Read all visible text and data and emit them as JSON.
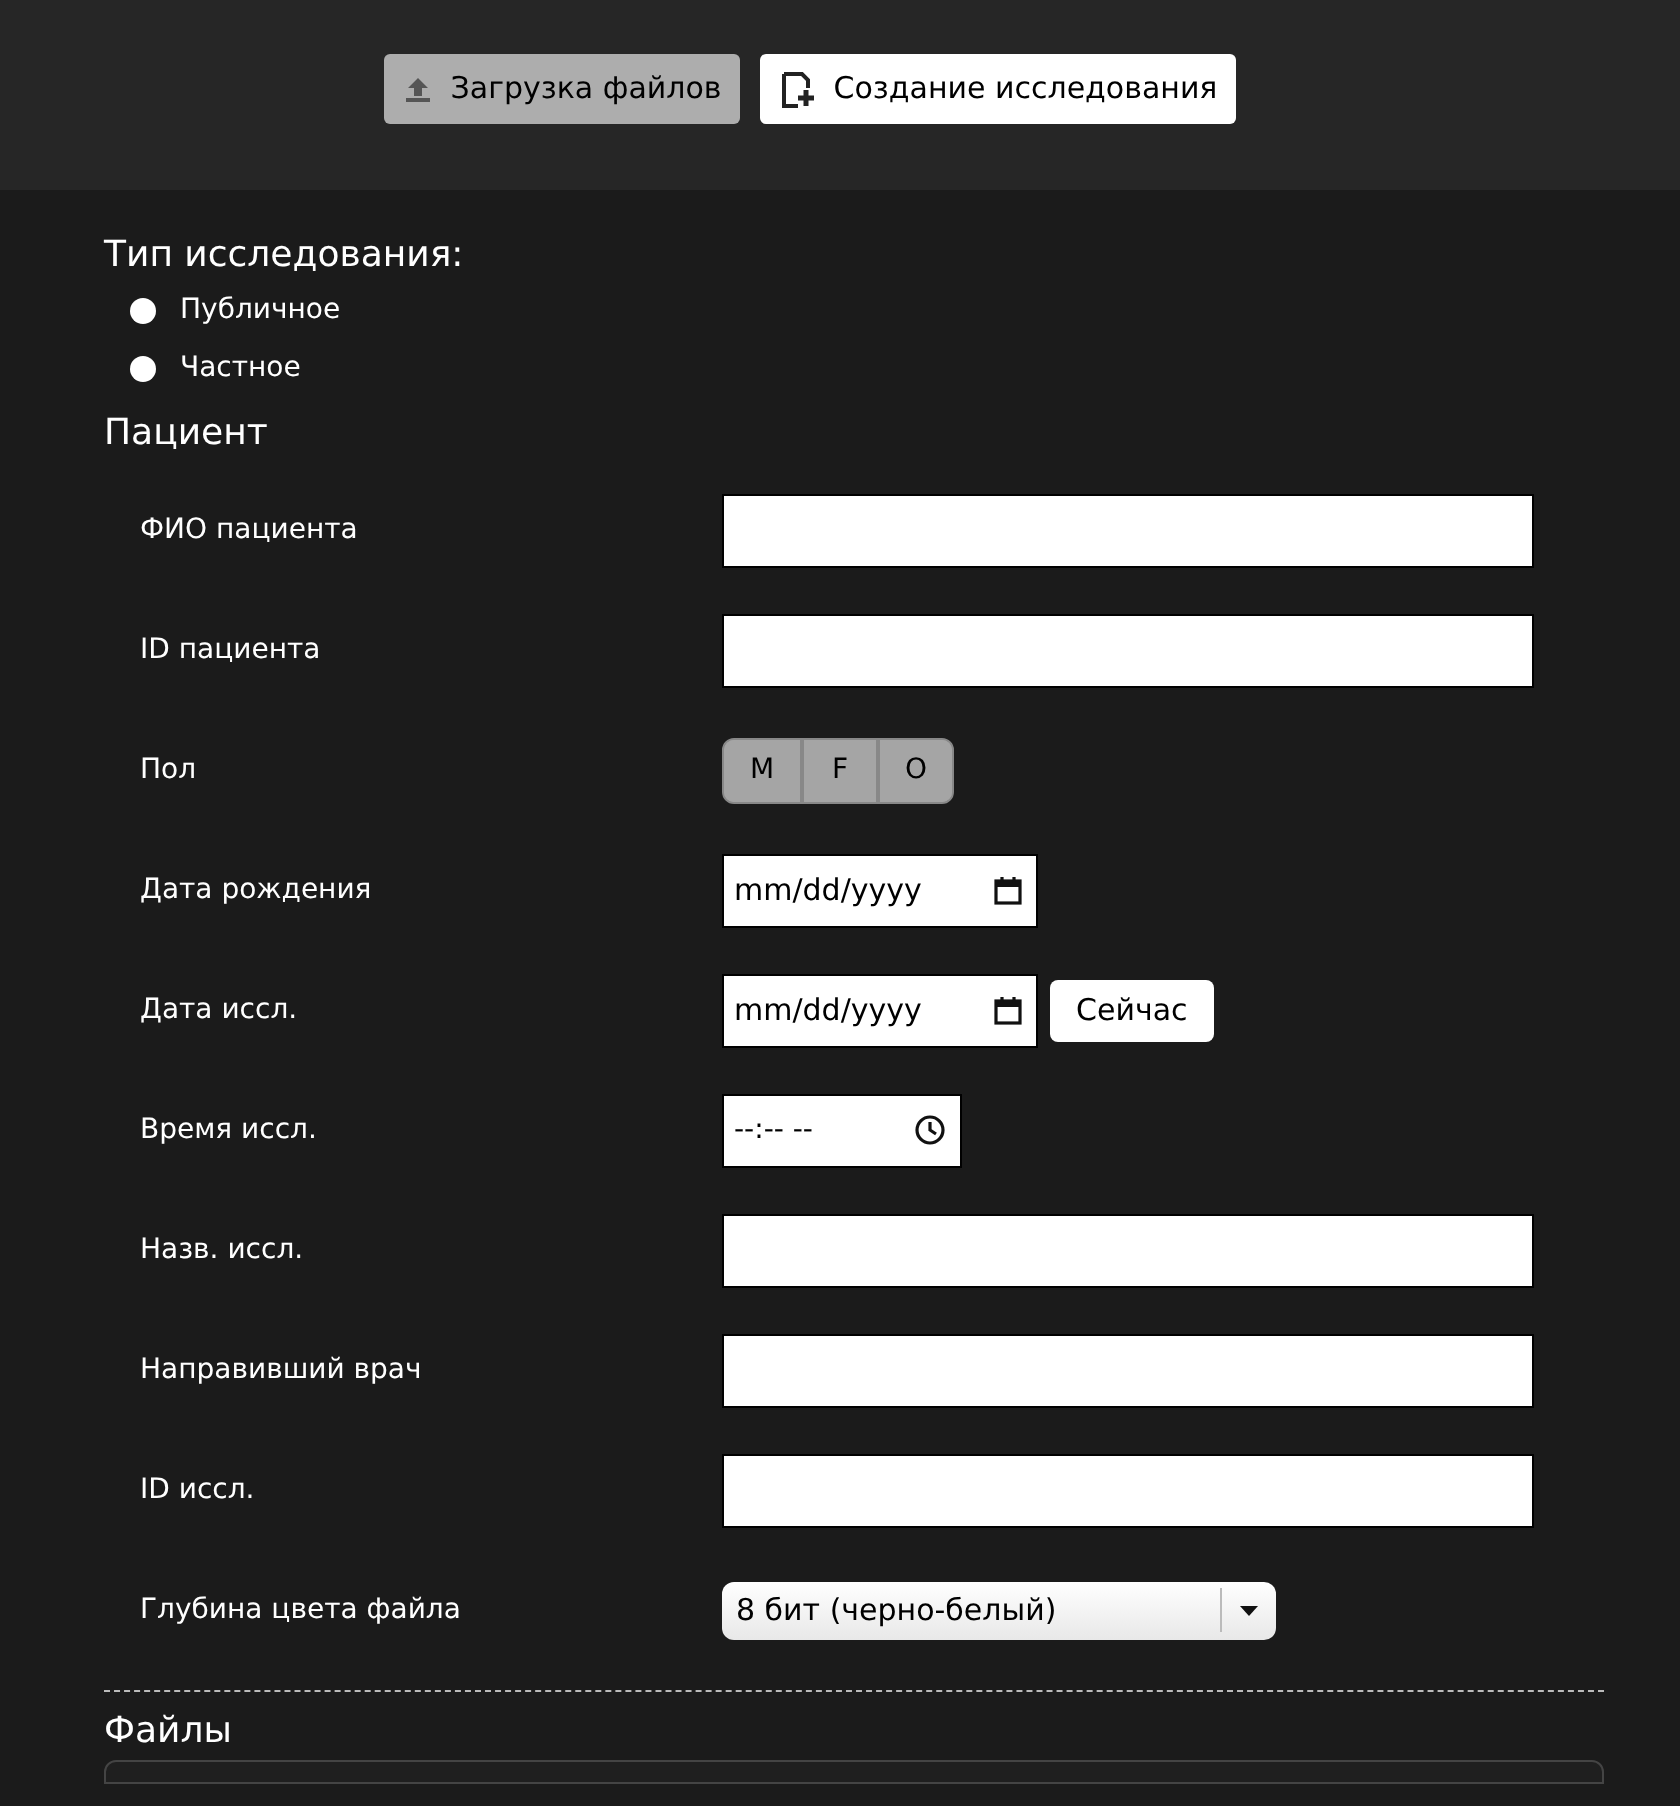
{
  "toolbar": [
    {
      "label": "Загрузка файлов",
      "kind": "upload",
      "selected": true
    },
    {
      "label": "Создание исследования",
      "kind": "create",
      "selected": false
    }
  ],
  "study_type": {
    "title": "Тип исследования:",
    "options": [
      {
        "label": "Публичное",
        "checked": false
      },
      {
        "label": "Частное",
        "checked": false
      }
    ]
  },
  "patient": {
    "title": "Пациент",
    "fields": [
      {
        "label": "ФИО пациента",
        "kind": "text"
      },
      {
        "label": "ID пациента",
        "kind": "text"
      },
      {
        "label": "Пол",
        "kind": "segmented",
        "options": [
          {
            "label": "M",
            "selected": false
          },
          {
            "label": "F",
            "selected": false
          },
          {
            "label": "O",
            "selected": false
          }
        ]
      },
      {
        "label": "Дата рождения",
        "kind": "date",
        "placeholder": "mm/dd/yyyy"
      },
      {
        "label": "Дата иссл.",
        "kind": "date",
        "placeholder": "mm/dd/yyyy",
        "button": "Сейчас"
      },
      {
        "label": "Время иссл.",
        "kind": "time",
        "placeholder": "--:-- --"
      },
      {
        "label": "Назв. иссл.",
        "kind": "text"
      },
      {
        "label": "Направивший врач",
        "kind": "text"
      },
      {
        "label": "ID иссл.",
        "kind": "text"
      },
      {
        "label": "Глубина цвета файла",
        "kind": "select",
        "value": "8 бит (черно-белый)"
      }
    ]
  },
  "files": {
    "title": "Файлы"
  }
}
